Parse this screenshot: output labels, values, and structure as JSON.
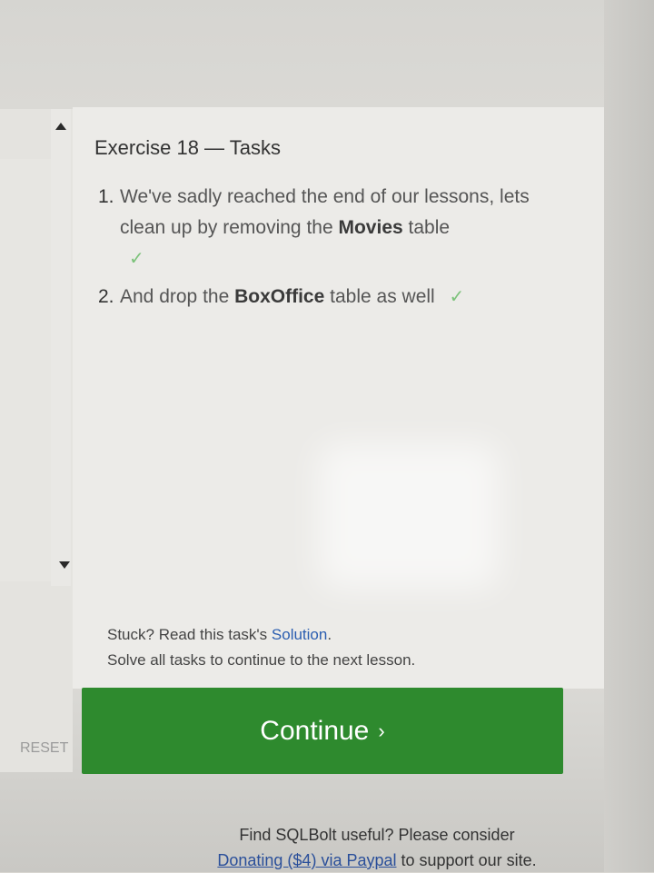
{
  "exercise": {
    "title": "Exercise 18 — Tasks"
  },
  "tasks": [
    {
      "number": "1.",
      "text_before": "We've sadly reached the end of our lessons, lets clean up by removing the",
      "bold": "Movies",
      "text_after": "table",
      "completed": true
    },
    {
      "number": "2.",
      "text_before": "And drop the",
      "bold": "BoxOffice",
      "text_after": "table as well",
      "completed": true
    }
  ],
  "check_mark": "✓",
  "help": {
    "stuck_prefix": "Stuck? Read this task's",
    "solution_link": "Solution",
    "stuck_suffix": ".",
    "solve_all": "Solve all tasks to continue to the next lesson."
  },
  "continue_button": {
    "label": "Continue",
    "chevron": "›"
  },
  "reset_label": "RESET",
  "footer": {
    "line1": "Find SQLBolt useful? Please consider",
    "link": "Donating ($4) via Paypal",
    "line2_suffix": "to support our site."
  },
  "colors": {
    "continue_green": "#2e8a2e",
    "check_green": "#7cc27a",
    "link_blue": "#2a5db0"
  },
  "icons": {
    "scroll_up": "triangle-up-icon",
    "scroll_down": "triangle-down-icon",
    "check": "checkmark-icon"
  }
}
